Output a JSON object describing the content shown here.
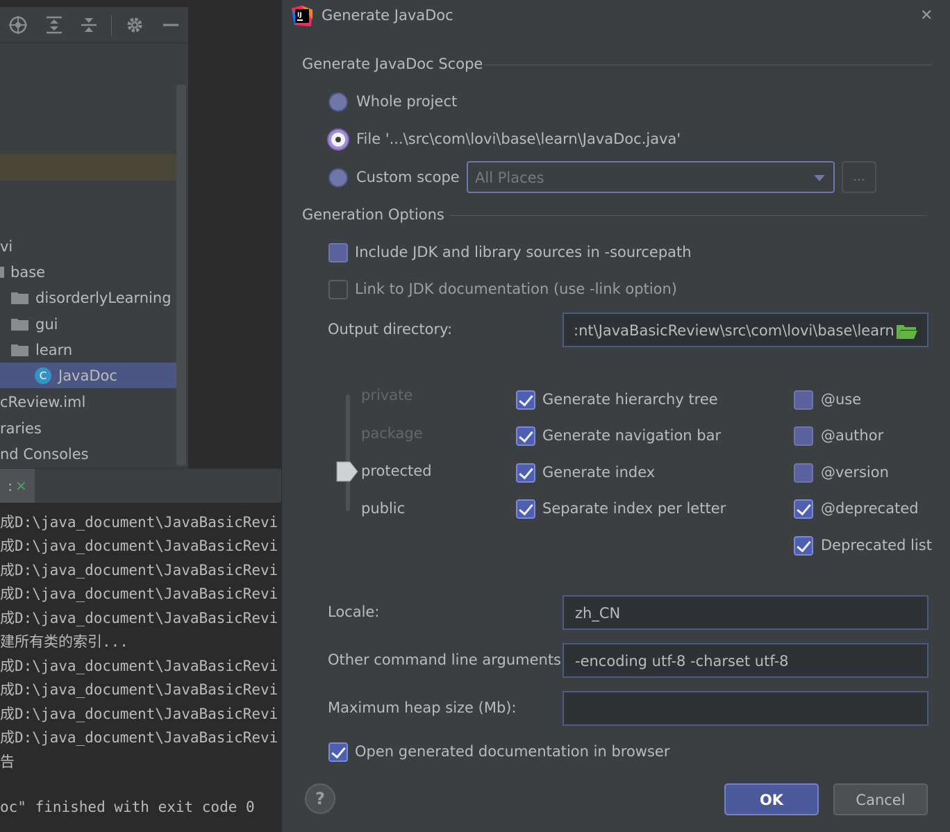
{
  "project_panel": {
    "tree": [
      {
        "label": "vi",
        "indent": "none"
      },
      {
        "label": "base",
        "indent": "none"
      },
      {
        "label": "disorderlyLearning",
        "type": "folder"
      },
      {
        "label": "gui",
        "type": "folder"
      },
      {
        "label": "learn",
        "type": "folder"
      },
      {
        "label": "JavaDoc",
        "type": "class",
        "selected": true
      },
      {
        "label": "cReview.iml"
      },
      {
        "label": "raries"
      },
      {
        "label": "nd Consoles"
      }
    ],
    "class_icon_letter": "C"
  },
  "run_panel": {
    "tab_close": "✕",
    "tab_prefix": ":",
    "lines": [
      "成D:\\java_document\\JavaBasicRevi",
      "成D:\\java_document\\JavaBasicRevi",
      "成D:\\java_document\\JavaBasicRevi",
      "成D:\\java_document\\JavaBasicRevi",
      "成D:\\java_document\\JavaBasicRevi",
      "建所有类的索引...",
      "成D:\\java_document\\JavaBasicRevi",
      "成D:\\java_document\\JavaBasicRevi",
      "成D:\\java_document\\JavaBasicRevi",
      "成D:\\java_document\\JavaBasicRevi",
      "告",
      "",
      "oc\" finished with exit code 0"
    ]
  },
  "dialog": {
    "title": "Generate JavaDoc",
    "logo_text": "IJ",
    "close": "✕",
    "scope": {
      "section_title": "Generate JavaDoc Scope",
      "whole_project": "Whole project",
      "file": "File '...\\src\\com\\lovi\\base\\learn\\JavaDoc.java'",
      "custom_scope": "Custom scope",
      "custom_scope_value": "All Places",
      "browse_button": "...",
      "selected": "file"
    },
    "options": {
      "section_title": "Generation Options",
      "include_jdk": {
        "label": "Include JDK and library sources in -sourcepath",
        "checked": false
      },
      "link_jdk": {
        "label": "Link to JDK documentation (use -link option)",
        "checked": false,
        "enabled": false
      },
      "output_directory_label": "Output directory:",
      "output_directory_value": ":nt\\JavaBasicReview\\src\\com\\lovi\\base\\learn"
    },
    "visibility": {
      "levels": [
        "private",
        "package",
        "protected",
        "public"
      ],
      "selected": "protected"
    },
    "generate": [
      {
        "label": "Generate hierarchy tree",
        "checked": true
      },
      {
        "label": "Generate navigation bar",
        "checked": true
      },
      {
        "label": "Generate index",
        "checked": true
      },
      {
        "label": "Separate index per letter",
        "checked": true
      }
    ],
    "tags": [
      {
        "label": "@use",
        "checked": false
      },
      {
        "label": "@author",
        "checked": false
      },
      {
        "label": "@version",
        "checked": false
      },
      {
        "label": "@deprecated",
        "checked": true
      },
      {
        "label": "Deprecated list",
        "checked": true
      }
    ],
    "locale_label": "Locale:",
    "locale_value": "zh_CN",
    "other_args_label": "Other command line arguments:",
    "other_args_value": "-encoding utf-8 -charset utf-8",
    "heap_label": "Maximum heap size (Mb):",
    "heap_value": "",
    "open_in_browser": {
      "label": "Open generated documentation in browser",
      "checked": true
    },
    "buttons": {
      "help": "?",
      "ok": "OK",
      "cancel": "Cancel"
    }
  }
}
